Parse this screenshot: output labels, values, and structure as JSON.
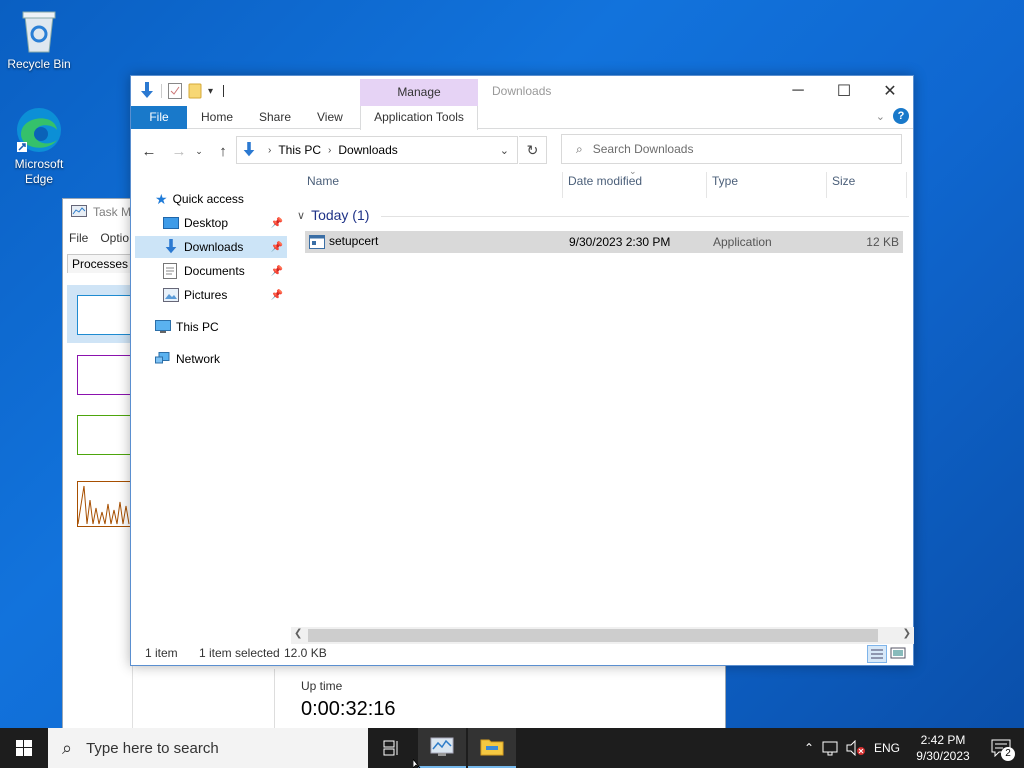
{
  "desktop": {
    "icons": [
      {
        "label": "Recycle Bin"
      },
      {
        "label": "Microsoft Edge"
      }
    ]
  },
  "task_manager": {
    "title": "Task Ma",
    "menu": [
      "File",
      "Optio"
    ],
    "tab": "Processes",
    "uptime_label": "Up time",
    "uptime_value": "0:00:32:16"
  },
  "explorer": {
    "title": "Downloads",
    "context_tab_group": "Manage",
    "ribbon_tabs": [
      "File",
      "Home",
      "Share",
      "View",
      "Application Tools"
    ],
    "address": {
      "root": "This PC",
      "current": "Downloads"
    },
    "search_placeholder": "Search Downloads",
    "nav": {
      "quick_access": "Quick access",
      "items": [
        "Desktop",
        "Downloads",
        "Documents",
        "Pictures"
      ],
      "this_pc": "This PC",
      "network": "Network"
    },
    "columns": [
      "Name",
      "Date modified",
      "Type",
      "Size"
    ],
    "group_label": "Today (1)",
    "files": [
      {
        "name": "setupcert",
        "date": "9/30/2023 2:30 PM",
        "type": "Application",
        "size": "12 KB"
      }
    ],
    "status": {
      "count": "1 item",
      "selected": "1 item selected",
      "size": "12.0 KB"
    }
  },
  "taskbar": {
    "search_placeholder": "Type here to search",
    "language": "ENG",
    "time": "2:42 PM",
    "date": "9/30/2023",
    "notifications": "2"
  }
}
